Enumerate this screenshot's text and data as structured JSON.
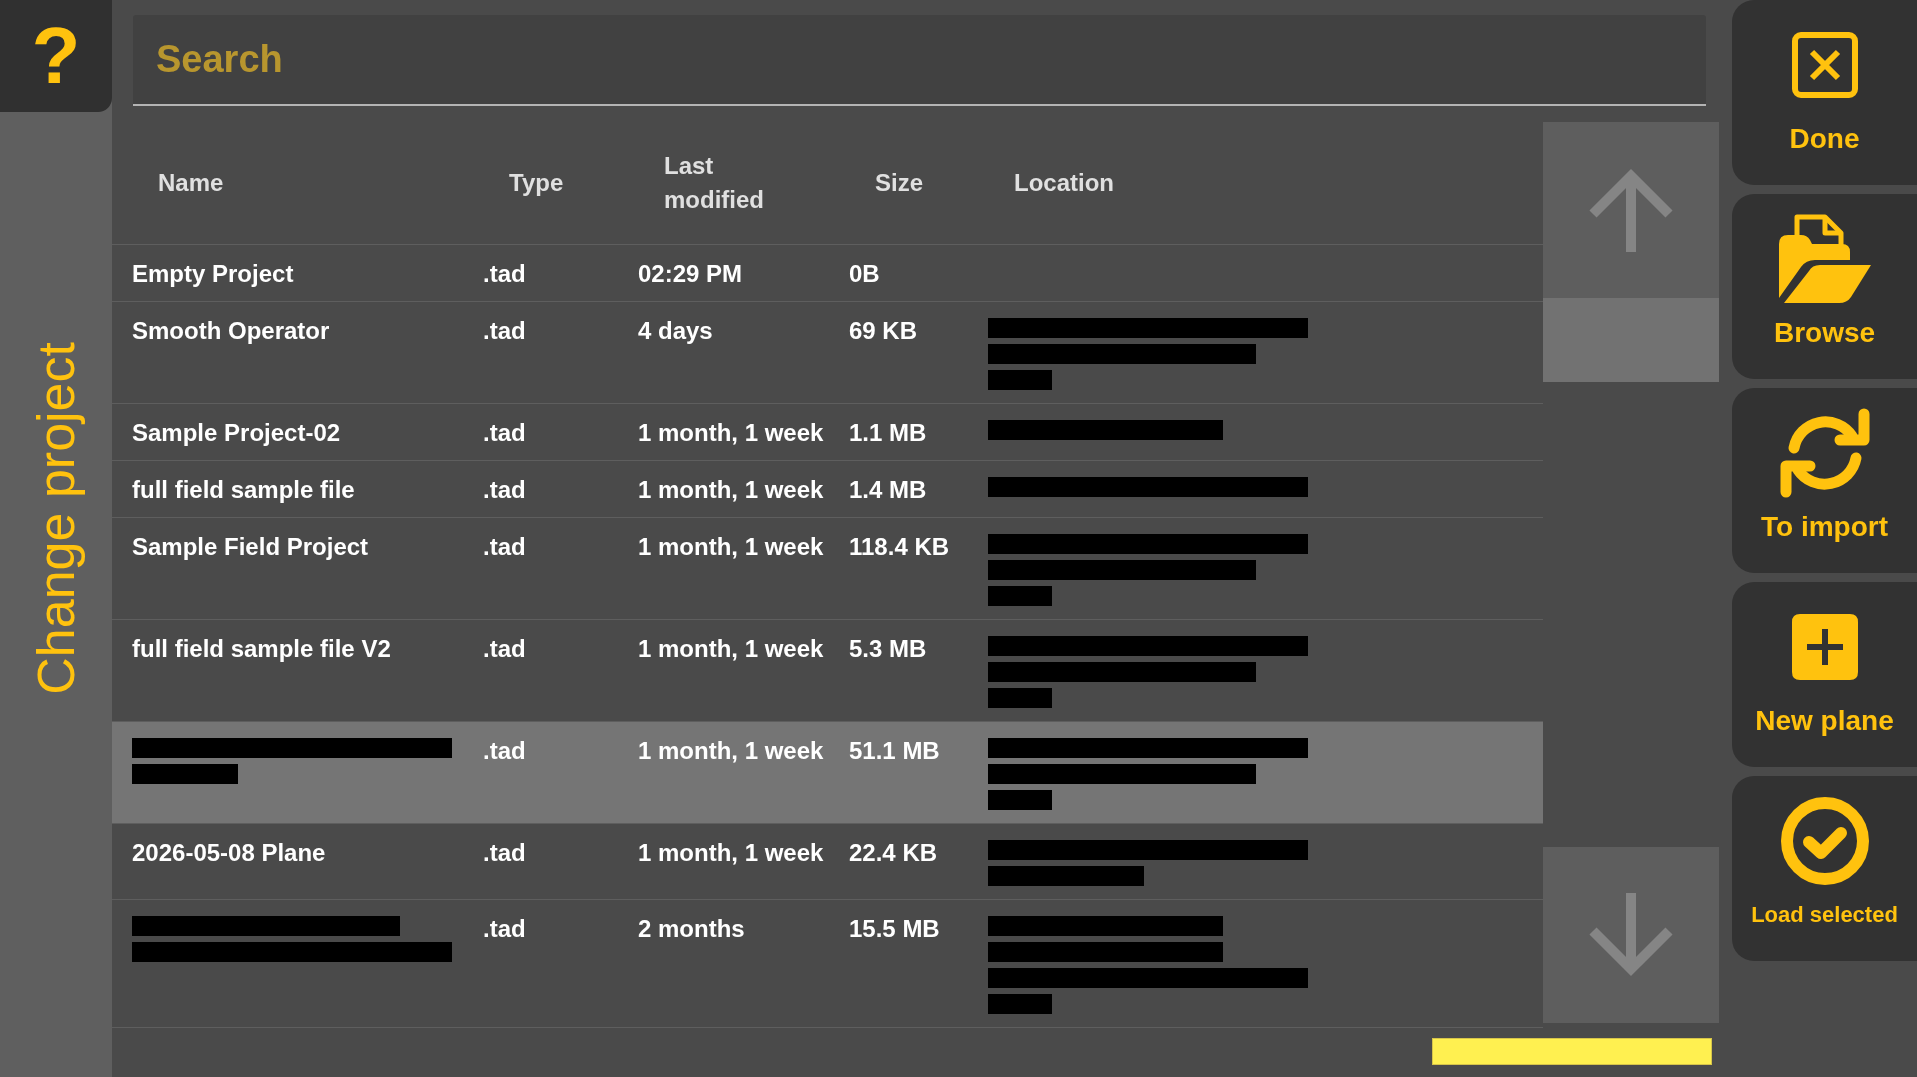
{
  "help_button": {
    "label": "?"
  },
  "sidebar": {
    "title": "Change project"
  },
  "search": {
    "placeholder": "Search"
  },
  "table": {
    "columns": [
      "Name",
      "Type",
      "Last modified",
      "Size",
      "Location"
    ],
    "rows": [
      {
        "name": "Empty Project",
        "type": ".tad",
        "modified": "02:29 PM",
        "size": "0B",
        "selected": false
      },
      {
        "name": "Smooth Operator",
        "type": ".tad",
        "modified": "4 days",
        "size": "69 KB",
        "location_redacted": [
          {
            "kind": "long"
          },
          {
            "kind": "medium"
          },
          {
            "kind": "short"
          }
        ],
        "selected": false
      },
      {
        "name": "Sample Project-02",
        "type": ".tad",
        "modified": "1 month, 1 week",
        "size": "1.1 MB",
        "location_redacted": [
          {
            "kind": "moderate"
          }
        ],
        "selected": false
      },
      {
        "name": "full field sample file",
        "type": ".tad",
        "modified": "1 month, 1 week",
        "size": "1.4 MB",
        "location_redacted": [
          {
            "kind": "long"
          }
        ],
        "selected": false
      },
      {
        "name": "Sample Field Project",
        "type": ".tad",
        "modified": "1 month, 1 week",
        "size": "118.4 KB",
        "location_redacted": [
          {
            "kind": "long"
          },
          {
            "kind": "medium"
          },
          {
            "kind": "short"
          }
        ],
        "selected": false
      },
      {
        "name": "full field sample file V2",
        "type": ".tad",
        "modified": "1 month, 1 week",
        "size": "5.3 MB",
        "location_redacted": [
          {
            "kind": "long"
          },
          {
            "kind": "medium"
          },
          {
            "kind": "short"
          }
        ],
        "selected": false
      },
      {
        "name_redacted": [
          {
            "kind": "long"
          },
          {
            "kind": "quarter"
          }
        ],
        "type": ".tad",
        "modified": "1 month, 1 week",
        "size": "51.1 MB",
        "location_redacted": [
          {
            "kind": "long"
          },
          {
            "kind": "medium"
          },
          {
            "kind": "short"
          }
        ],
        "selected": true
      },
      {
        "name": "2026-05-08 Plane",
        "type": ".tad",
        "modified": "1 month, 1 week",
        "size": "22.4 KB",
        "location_redacted": [
          {
            "kind": "long"
          },
          {
            "kind": "half"
          }
        ],
        "selected": false
      },
      {
        "name_redacted": [
          {
            "kind": "medium"
          },
          {
            "kind": "long"
          }
        ],
        "type": ".tad",
        "modified": "2 months",
        "size": "15.5 MB",
        "location_redacted": [
          {
            "kind": "moderate"
          },
          {
            "kind": "moderate"
          },
          {
            "kind": "long"
          },
          {
            "kind": "short"
          }
        ],
        "selected": false
      }
    ]
  },
  "actions": [
    {
      "kind": "done",
      "label": "Done"
    },
    {
      "kind": "browse",
      "label": "Browse"
    },
    {
      "kind": "import",
      "label": "To import"
    },
    {
      "kind": "new",
      "label": "New plane"
    },
    {
      "kind": "load",
      "label": "Load selected"
    }
  ]
}
